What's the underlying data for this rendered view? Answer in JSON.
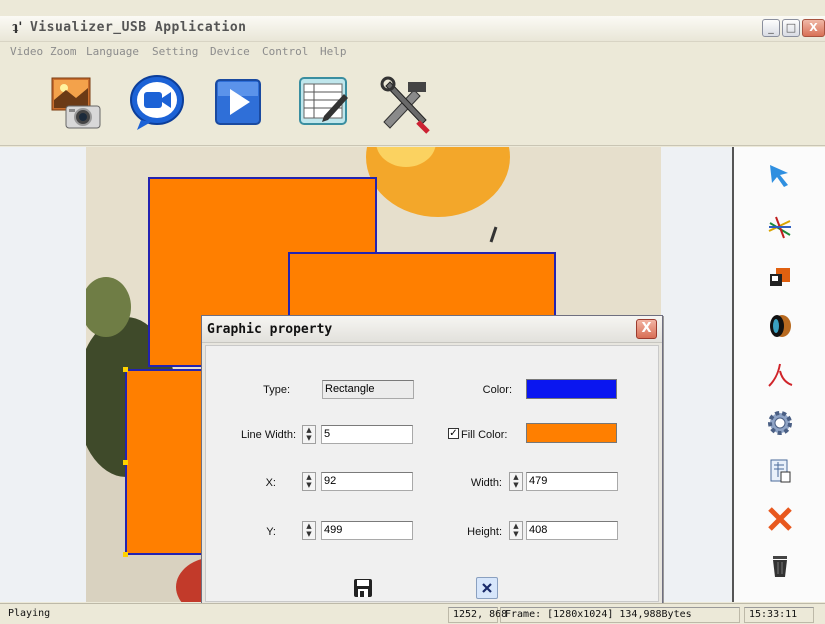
{
  "window": {
    "title": "Visualizer_USB Application",
    "logo_glyph": "ʇ'",
    "minimize_glyph": "_",
    "maximize_glyph": "□",
    "close_glyph": "X"
  },
  "menu": {
    "items": [
      "Video",
      "Zoom",
      "Language",
      "Setting",
      "Device",
      "Control",
      "Help"
    ]
  },
  "toolbar": {
    "icons": [
      "camera-snapshot",
      "video-record",
      "play",
      "edit-document",
      "settings-tools"
    ]
  },
  "side_tools": {
    "icons": [
      "select-arrow",
      "freehand-lines",
      "rectangle-shape",
      "ellipse-shape",
      "curve-line",
      "gear",
      "properties-doc",
      "delete-x",
      "trash-bin"
    ]
  },
  "dialog": {
    "title": "Graphic property",
    "close_glyph": "X",
    "type_label": "Type:",
    "type_value": "Rectangle",
    "line_width_label": "Line Width:",
    "line_width_value": "5",
    "x_label": "X:",
    "x_value": "92",
    "y_label": "Y:",
    "y_value": "499",
    "color_label": "Color:",
    "color_hex": "#0a16f0",
    "fill_color_checked": "✓",
    "fill_color_label": "Fill Color:",
    "fill_color_hex": "#ff7f00",
    "width_label": "Width:",
    "width_value": "479",
    "height_label": "Height:",
    "height_value": "408",
    "spin_up": "▲",
    "spin_down": "▼"
  },
  "status": {
    "state": "Playing",
    "coords": "1252, 868",
    "frame": "Frame: [1280x1024] 134,988Bytes",
    "time": "15:33:11"
  },
  "colors": {
    "shape_fill": "#ff7f00",
    "shape_border": "#2323b0"
  }
}
